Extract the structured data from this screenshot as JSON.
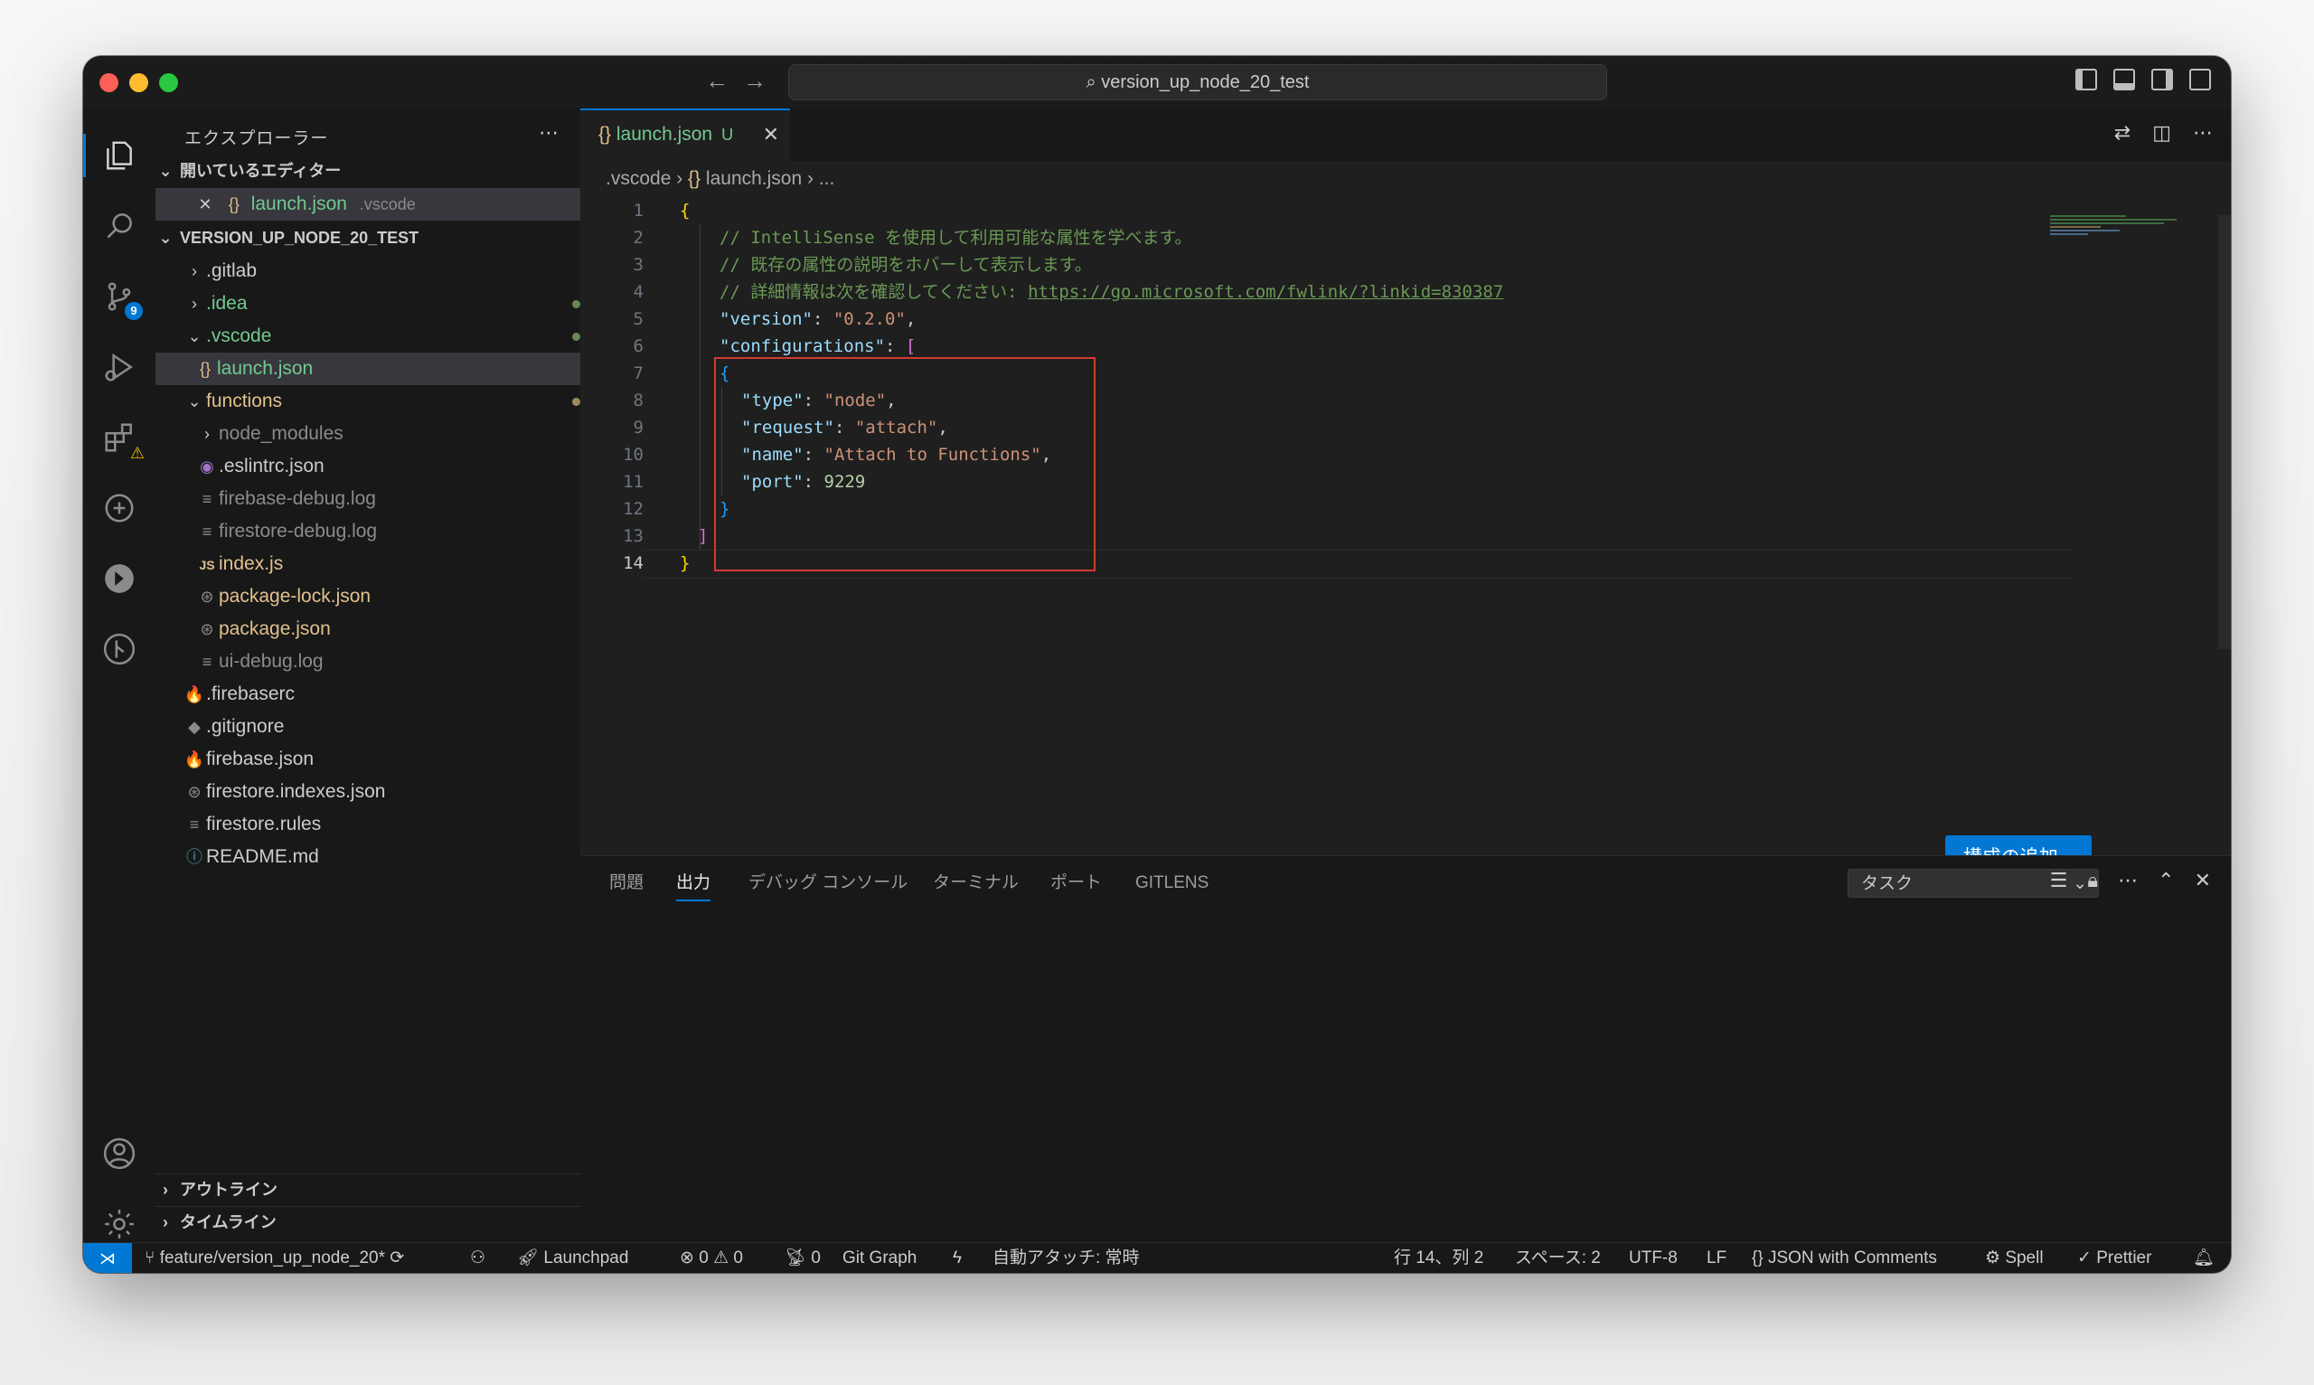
{
  "window": {
    "title": "version_up_node_20_test"
  },
  "activity": {
    "scm_badge": "9"
  },
  "sidebar": {
    "title": "エクスプローラー",
    "open_editors": {
      "label": "開いているエディター",
      "file": "launch.json",
      "folder": ".vscode",
      "status": "U"
    },
    "project": {
      "label": "VERSION_UP_NODE_20_TEST"
    },
    "tree": [
      {
        "name": ".gitlab",
        "status": ""
      },
      {
        "name": ".idea",
        "status": "dot"
      },
      {
        "name": ".vscode",
        "status": "dot"
      },
      {
        "name": "launch.json",
        "status": "U"
      },
      {
        "name": "functions",
        "status": "dot"
      },
      {
        "name": "node_modules",
        "status": ""
      },
      {
        "name": ".eslintrc.json",
        "status": ""
      },
      {
        "name": "firebase-debug.log",
        "status": ""
      },
      {
        "name": "firestore-debug.log",
        "status": ""
      },
      {
        "name": "index.js",
        "status": "M"
      },
      {
        "name": "package-lock.json",
        "status": "M"
      },
      {
        "name": "package.json",
        "status": "M"
      },
      {
        "name": "ui-debug.log",
        "status": ""
      },
      {
        "name": ".firebaserc",
        "status": ""
      },
      {
        "name": ".gitignore",
        "status": ""
      },
      {
        "name": "firebase.json",
        "status": ""
      },
      {
        "name": "firestore.indexes.json",
        "status": ""
      },
      {
        "name": "firestore.rules",
        "status": ""
      },
      {
        "name": "README.md",
        "status": ""
      }
    ],
    "outline": "アウトライン",
    "timeline": "タイムライン"
  },
  "editor": {
    "tab": {
      "label": "launch.json",
      "status": "U"
    },
    "breadcrumb": {
      "folder": ".vscode",
      "file": "launch.json",
      "more": "..."
    },
    "lines": {
      "c1": "// IntelliSense を使用して利用可能な属性を学べます。",
      "c2": "// 既存の属性の説明をホバーして表示します。",
      "c3": "// 詳細情報は次を確認してください: ",
      "c3_link": "https://go.microsoft.com/fwlink/?linkid=830387",
      "version_key": "\"version\"",
      "version_val": "\"0.2.0\"",
      "configs_key": "\"configurations\"",
      "type_key": "\"type\"",
      "type_val": "\"node\"",
      "request_key": "\"request\"",
      "request_val": "\"attach\"",
      "name_key": "\"name\"",
      "name_val": "\"Attach to Functions\"",
      "port_key": "\"port\"",
      "port_val": "9229"
    },
    "add_config_button": "構成の追加..."
  },
  "panel": {
    "tabs": [
      "問題",
      "出力",
      "デバッグ コンソール",
      "ターミナル",
      "ポート",
      "GITLENS"
    ],
    "active_tab": "出力",
    "select_value": "タスク"
  },
  "statusbar": {
    "branch": "feature/version_up_node_20*",
    "launchpad": "Launchpad",
    "errors": "0",
    "warnings": "0",
    "ports": "0",
    "git_graph": "Git Graph",
    "auto_attach": "自動アタッチ: 常時",
    "position": "行 14、列 2",
    "spaces": "スペース: 2",
    "encoding": "UTF-8",
    "eol": "LF",
    "language": "JSON with Comments",
    "spell": "Spell",
    "prettier": "Prettier"
  }
}
